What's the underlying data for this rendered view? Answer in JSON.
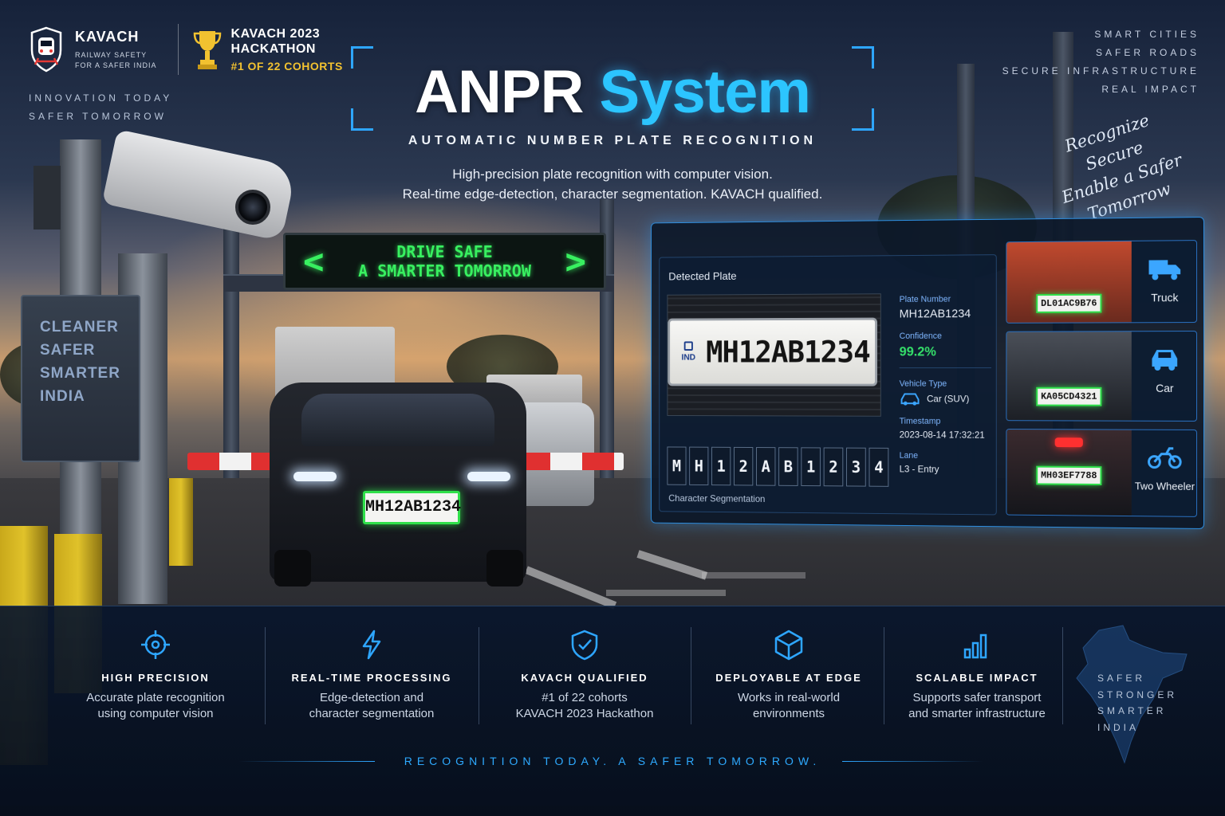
{
  "brand": {
    "name": "KAVACH",
    "sub_line1": "RAILWAY SAFETY",
    "sub_line2": "FOR A SAFER INDIA",
    "hackathon_line1": "KAVACH 2023",
    "hackathon_line2": "HACKATHON",
    "hackathon_rank": "#1 OF 22 COHORTS",
    "logo_icon": "train-shield-icon",
    "trophy_icon": "trophy-icon"
  },
  "tagline_left": [
    "INNOVATION TODAY",
    "SAFER TOMORROW"
  ],
  "tagline_right": [
    "SMART CITIES",
    "SAFER ROADS",
    "SECURE INFRASTRUCTURE",
    "REAL IMPACT"
  ],
  "script_text": [
    "Recognize",
    "Secure",
    "Enable a Safer Tomorrow"
  ],
  "hero": {
    "title_part1": "ANPR",
    "title_part2": "System",
    "subtitle": "AUTOMATIC NUMBER PLATE RECOGNITION",
    "description_line1": "High-precision plate recognition with computer vision.",
    "description_line2": "Real-time edge-detection, character segmentation. KAVACH qualified."
  },
  "led_board": {
    "line1": "DRIVE SAFE",
    "line2": "A SMARTER TOMORROW",
    "left_arrow": "<",
    "right_arrow": ">"
  },
  "roadside_sign": [
    "CLEANER",
    "SAFER",
    "SMARTER",
    "INDIA"
  ],
  "scene_plate": "MH12AB1234",
  "dashboard": {
    "detected_label": "Detected Plate",
    "plate_country": "IND",
    "plate_number": "MH12AB1234",
    "segments": [
      "M",
      "H",
      "1",
      "2",
      "A",
      "B",
      "1",
      "2",
      "3",
      "4"
    ],
    "segmentation_label": "Character Segmentation",
    "info": {
      "plate_number_key": "Plate Number",
      "plate_number_val": "MH12AB1234",
      "confidence_key": "Confidence",
      "confidence_val": "99.2%",
      "vehicle_type_key": "Vehicle Type",
      "vehicle_type_val": "Car (SUV)",
      "timestamp_key": "Timestamp",
      "timestamp_val": "2023-08-14 17:32:21",
      "lane_key": "Lane",
      "lane_val": "L3 - Entry"
    },
    "vehicles": [
      {
        "plate": "DL01AC9B76",
        "type": "Truck",
        "icon": "truck-icon"
      },
      {
        "plate": "KA05CD4321",
        "type": "Car",
        "icon": "car-icon"
      },
      {
        "plate": "MH03EF7788",
        "type": "Two Wheeler",
        "icon": "motorcycle-icon"
      }
    ]
  },
  "features": [
    {
      "icon": "crosshair-icon",
      "title": "HIGH PRECISION",
      "line1": "Accurate plate recognition",
      "line2": "using computer vision"
    },
    {
      "icon": "lightning-icon",
      "title": "REAL-TIME PROCESSING",
      "line1": "Edge-detection and",
      "line2": "character segmentation"
    },
    {
      "icon": "shield-check-icon",
      "title": "KAVACH QUALIFIED",
      "line1": "#1 of 22 cohorts",
      "line2": "KAVACH 2023 Hackathon"
    },
    {
      "icon": "cube-icon",
      "title": "DEPLOYABLE AT EDGE",
      "line1": "Works in real-world",
      "line2": "environments"
    },
    {
      "icon": "bar-chart-icon",
      "title": "SCALABLE IMPACT",
      "line1": "Supports safer transport",
      "line2": "and smarter infrastructure"
    }
  ],
  "india_note": [
    "SAFER",
    "STRONGER",
    "SMARTER",
    "INDIA"
  ],
  "footer": "RECOGNITION TODAY.  A SAFER TOMORROW.",
  "colors": {
    "accent": "#2cc5ff",
    "plate_highlight": "#2fe04a",
    "rank_gold": "#f2c230"
  }
}
